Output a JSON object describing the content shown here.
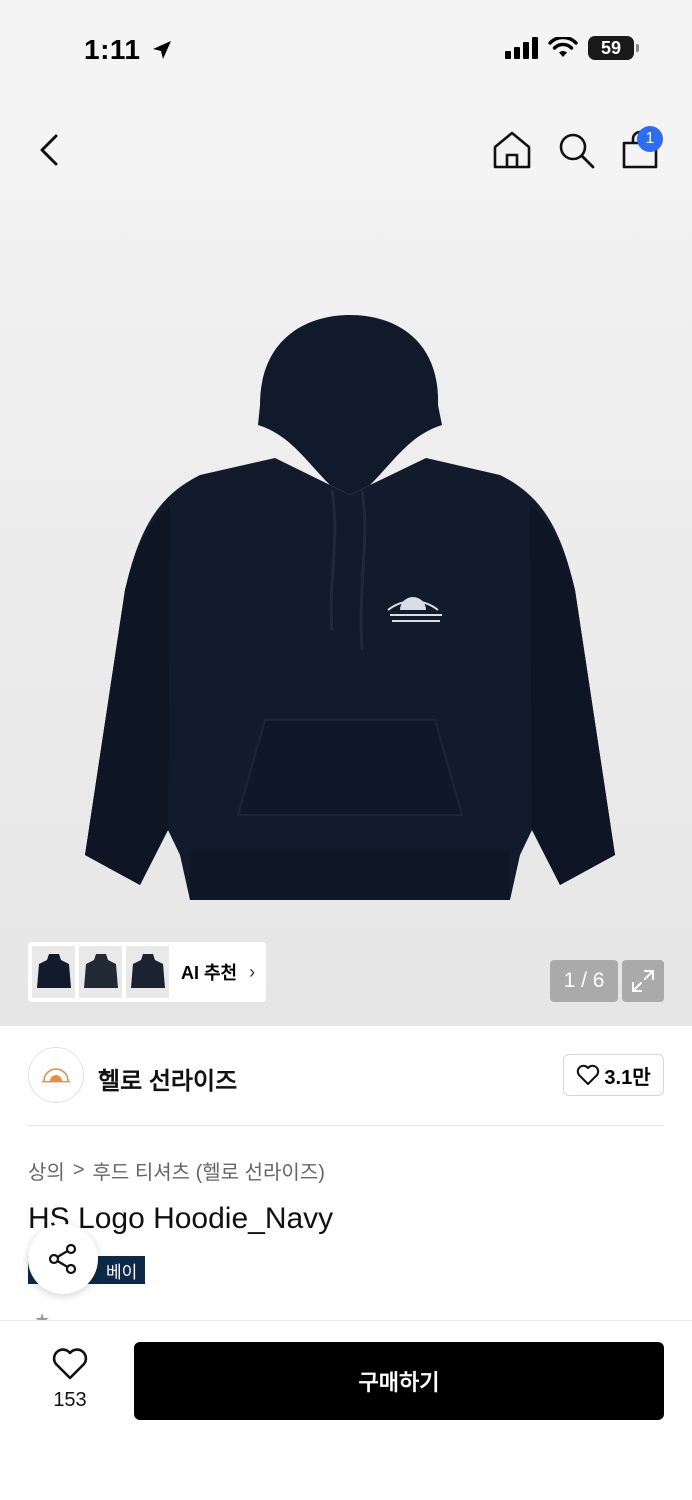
{
  "status": {
    "time": "1:11",
    "battery": "59"
  },
  "nav": {
    "cart_count": "1"
  },
  "gallery": {
    "page_indicator": "1 / 6",
    "ai_label": "AI 추천"
  },
  "brand": {
    "name": "헬로 선라이즈",
    "likes": "3.1만"
  },
  "breadcrumb": {
    "level1": "상의",
    "separator": ">",
    "level2": "후드 티셔츠 (헬로 선라이즈)"
  },
  "product": {
    "title": "HS Logo Hoodie_Navy",
    "tag": "베이"
  },
  "bottom": {
    "wish_count": "153",
    "buy_label": "구매하기"
  },
  "colors": {
    "accent": "#2f6cf6",
    "tag_bg": "#0c2a47",
    "buy_bg": "#000000"
  },
  "icons": [
    "back-icon",
    "home-icon",
    "search-icon",
    "bag-icon",
    "expand-icon",
    "heart-icon",
    "share-icon",
    "chevron-right-icon",
    "location-arrow-icon",
    "wifi-icon",
    "signal-icon"
  ]
}
